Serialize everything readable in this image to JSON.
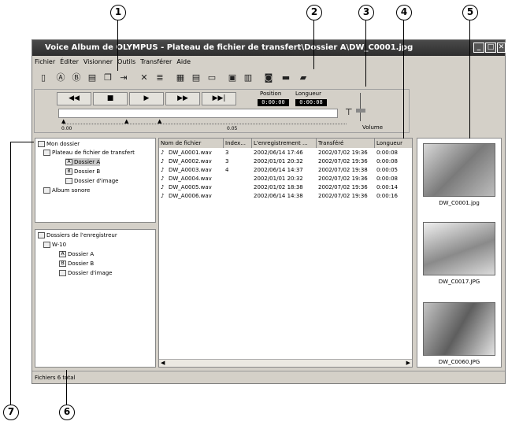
{
  "callouts": [
    "1",
    "2",
    "3",
    "4",
    "5",
    "6",
    "7"
  ],
  "window": {
    "title": "Voice Album de OLYMPUS - Plateau de fichier de transfert\\Dossier A\\DW_C0001.jpg",
    "controls": [
      "_",
      "□",
      "✕"
    ]
  },
  "menu": [
    "Fichier",
    "Éditer",
    "Visionner",
    "Outils",
    "Transférer",
    "Aide"
  ],
  "player": {
    "buttons": [
      "◀◀",
      "■",
      "▶",
      "▶▶",
      "▶▶|"
    ],
    "position_label": "Position",
    "position_value": "0:00:00",
    "length_label": "Longueur",
    "length_value": "0:00:08",
    "scale_start": "0.00",
    "scale_mid": "0.05",
    "volume_label": "Volume"
  },
  "tree_a": {
    "root": "Mon dossier",
    "transfer": "Plateau de fichier de transfert",
    "folders": [
      "Dossier A",
      "Dossier B",
      "Dossier d'image"
    ],
    "album": "Album sonore"
  },
  "tree_b": {
    "root": "Dossiers de l'enregistreur",
    "device": "W-10",
    "folders": [
      "Dossier A",
      "Dossier B",
      "Dossier d'image"
    ]
  },
  "list": {
    "headers": [
      "Nom de fichier",
      "Index...",
      "L'enregistrement ...",
      "Transféré",
      "Longueur"
    ],
    "rows": [
      [
        "DW_A0001.wav",
        "3",
        "2002/06/14 17:46",
        "2002/07/02 19:36",
        "0:00:08"
      ],
      [
        "DW_A0002.wav",
        "3",
        "2002/01/01 20:32",
        "2002/07/02 19:36",
        "0:00:08"
      ],
      [
        "DW_A0003.wav",
        "4",
        "2002/06/14 14:37",
        "2002/07/02 19:38",
        "0:00:05"
      ],
      [
        "DW_A0004.wav",
        "",
        "2002/01/01 20:32",
        "2002/07/02 19:36",
        "0:00:08"
      ],
      [
        "DW_A0005.wav",
        "",
        "2002/01/02 18:38",
        "2002/07/02 19:36",
        "0:00:14"
      ],
      [
        "DW_A0006.wav",
        "",
        "2002/06/14 14:38",
        "2002/07/02 19:36",
        "0:00:16"
      ]
    ]
  },
  "thumbnails": [
    "DW_C0001.jpg",
    "DW_C0017.JPG",
    "DW_C0060.JPG"
  ],
  "status": "Fichiers 6 total"
}
